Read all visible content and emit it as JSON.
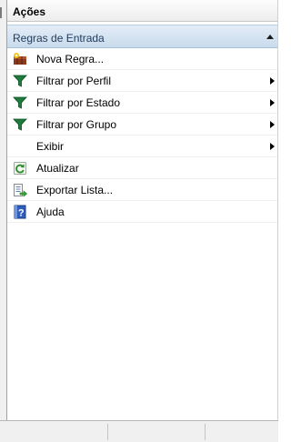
{
  "actions_pane": {
    "title": "Ações",
    "section": {
      "title": "Regras de Entrada",
      "items": [
        {
          "label": "Nova Regra...",
          "icon": "new-rule-icon"
        },
        {
          "label": "Filtrar por Perfil",
          "icon": "filter-icon",
          "submenu": true
        },
        {
          "label": "Filtrar por Estado",
          "icon": "filter-icon",
          "submenu": true
        },
        {
          "label": "Filtrar por Grupo",
          "icon": "filter-icon",
          "submenu": true
        },
        {
          "label": "Exibir",
          "icon": "",
          "submenu": true
        },
        {
          "label": "Atualizar",
          "icon": "refresh-icon"
        },
        {
          "label": "Exportar Lista...",
          "icon": "export-list-icon"
        },
        {
          "label": "Ajuda",
          "icon": "help-icon"
        }
      ]
    }
  },
  "colors": {
    "section_header_bg": "#c9dbec",
    "filter_icon": "#1f7a3e",
    "help_icon": "#2e5fbf"
  }
}
